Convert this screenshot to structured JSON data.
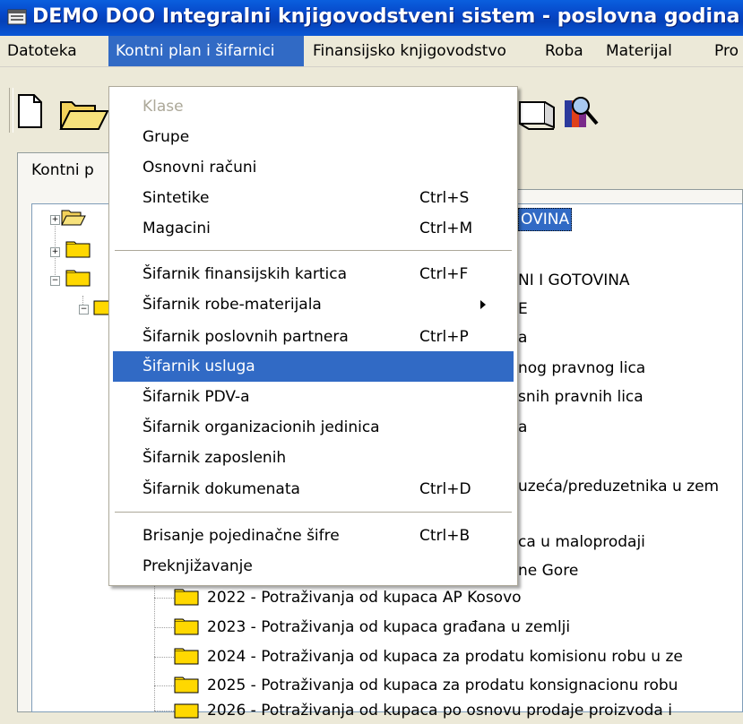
{
  "window": {
    "title": "DEMO DOO Integralni knjigovodstveni sistem - poslovna godina"
  },
  "menubar": {
    "items": [
      {
        "label": "Datoteka"
      },
      {
        "label": "Kontni plan i šifarnici"
      },
      {
        "label": "Finansijsko knjigovodstvo"
      },
      {
        "label": "Roba"
      },
      {
        "label": "Materijal"
      },
      {
        "label": "Pro"
      }
    ]
  },
  "tab": {
    "label": "Kontni p"
  },
  "tree": {
    "top_labels": [
      "OVINA",
      "NI I GOTOVINA",
      "E",
      "a",
      "nog pravnog lica",
      "snih pravnih lica",
      "a",
      "uzeća/preduzetnika u zem",
      "ca u maloprodaji",
      "ne Gore"
    ],
    "rows": [
      "2022 - Potraživanja od kupaca AP Kosovo",
      "2023 - Potraživanja od kupaca građana u zemlji",
      "2024 - Potraživanja od kupaca za prodatu komisionu robu u ze",
      "2025 - Potraživanja od kupaca za prodatu konsignacionu robu",
      "2026 - Potraživanja od kupaca po osnovu prodaje proizvoda i"
    ]
  },
  "dropdown": {
    "items": [
      {
        "label": "Klase",
        "shortcut": "",
        "disabled": true
      },
      {
        "label": "Grupe",
        "shortcut": ""
      },
      {
        "label": "Osnovni računi",
        "shortcut": ""
      },
      {
        "label": "Sintetike",
        "shortcut": "Ctrl+S"
      },
      {
        "label": "Magacini",
        "shortcut": "Ctrl+M"
      },
      {
        "label": "Šifarnik finansijskih kartica",
        "shortcut": "Ctrl+F"
      },
      {
        "label": "Šifarnik robe-materijala",
        "shortcut": "",
        "submenu": true
      },
      {
        "label": "Šifarnik poslovnih partnera",
        "shortcut": "Ctrl+P"
      },
      {
        "label": "Šifarnik usluga",
        "shortcut": "",
        "highlighted": true
      },
      {
        "label": "Šifarnik PDV-a",
        "shortcut": ""
      },
      {
        "label": "Šifarnik organizacionih jedinica",
        "shortcut": ""
      },
      {
        "label": "Šifarnik zaposlenih",
        "shortcut": ""
      },
      {
        "label": "Šifarnik dokumenata",
        "shortcut": "Ctrl+D"
      },
      {
        "label": "Brisanje pojedinačne šifre",
        "shortcut": "Ctrl+B"
      },
      {
        "label": "Preknjižavanje",
        "shortcut": ""
      }
    ]
  },
  "colors": {
    "titlebar": "#0a5fde",
    "highlight": "#316ac5",
    "folder": "#ffd800"
  }
}
